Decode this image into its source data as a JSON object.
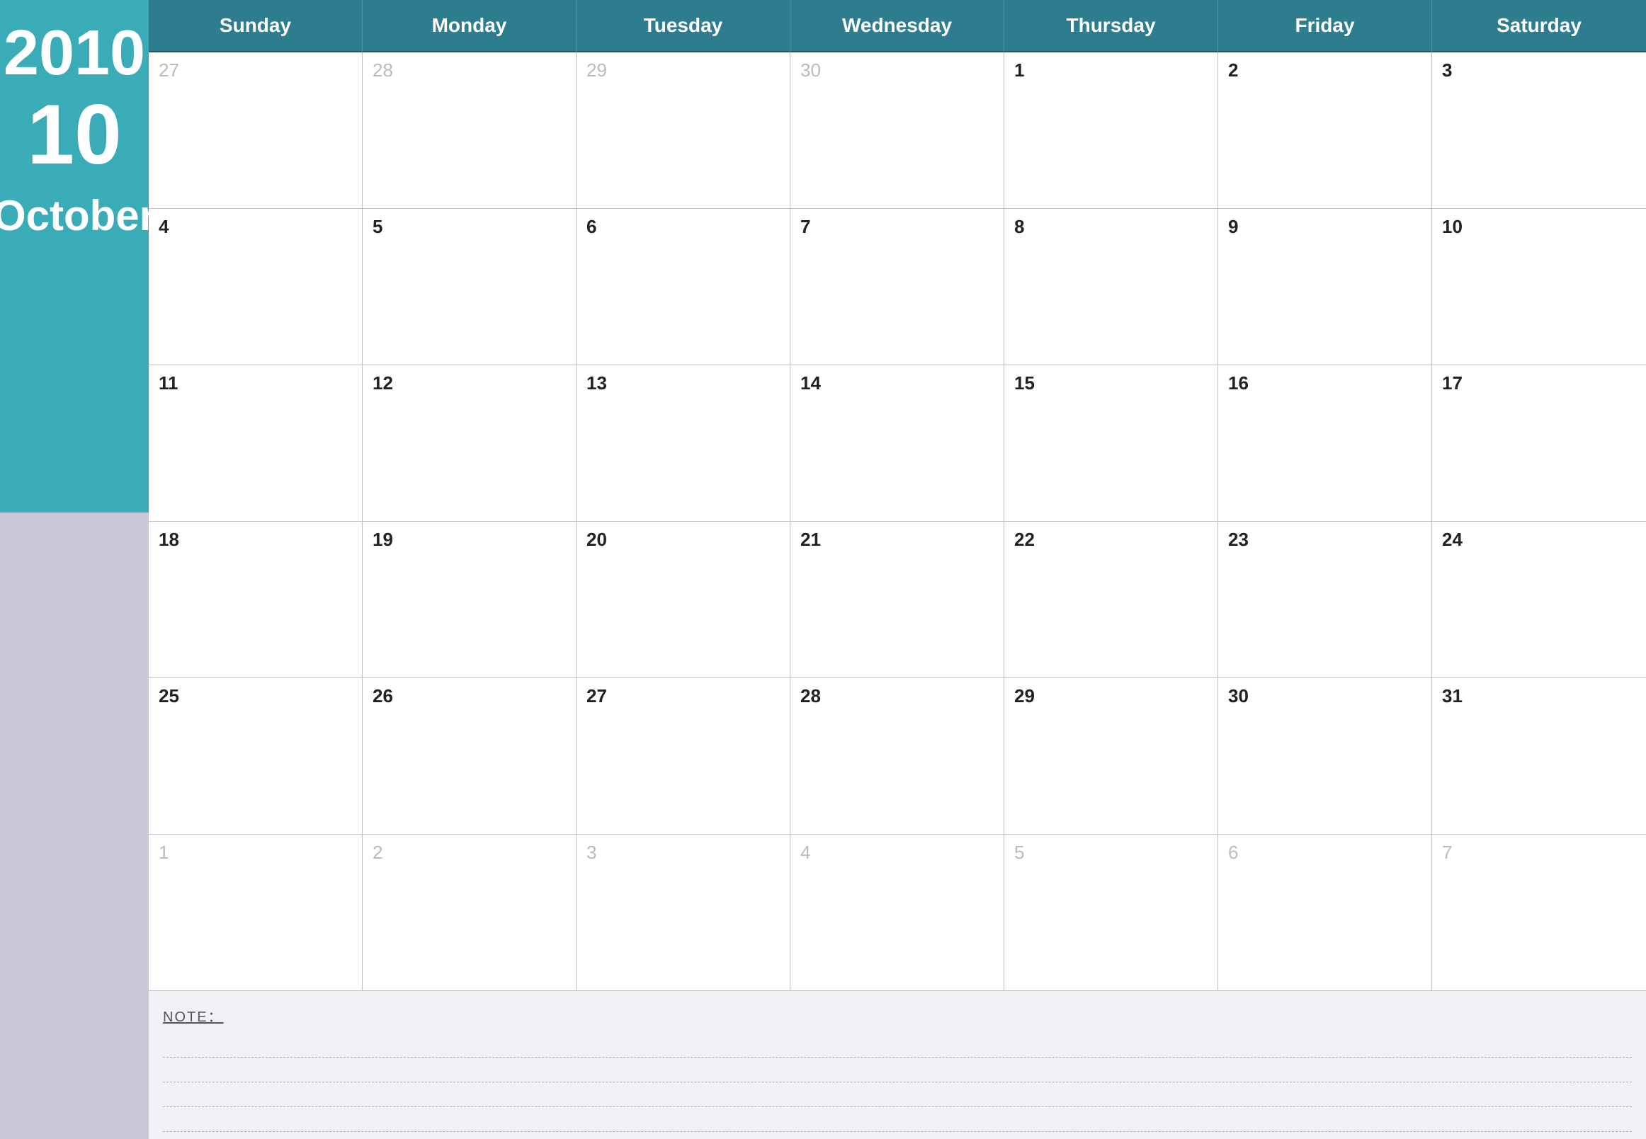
{
  "sidebar": {
    "year": "2010",
    "month_num": "10",
    "month_name": "October"
  },
  "header": {
    "days": [
      "Sunday",
      "Monday",
      "Tuesday",
      "Wednesday",
      "Thursday",
      "Friday",
      "Saturday"
    ]
  },
  "weeks": [
    [
      {
        "num": "27",
        "muted": true
      },
      {
        "num": "28",
        "muted": true
      },
      {
        "num": "29",
        "muted": true
      },
      {
        "num": "30",
        "muted": true
      },
      {
        "num": "1",
        "muted": false
      },
      {
        "num": "2",
        "muted": false
      },
      {
        "num": "3",
        "muted": false
      }
    ],
    [
      {
        "num": "4",
        "muted": false
      },
      {
        "num": "5",
        "muted": false
      },
      {
        "num": "6",
        "muted": false
      },
      {
        "num": "7",
        "muted": false
      },
      {
        "num": "8",
        "muted": false
      },
      {
        "num": "9",
        "muted": false
      },
      {
        "num": "10",
        "muted": false
      }
    ],
    [
      {
        "num": "11",
        "muted": false
      },
      {
        "num": "12",
        "muted": false
      },
      {
        "num": "13",
        "muted": false
      },
      {
        "num": "14",
        "muted": false
      },
      {
        "num": "15",
        "muted": false
      },
      {
        "num": "16",
        "muted": false
      },
      {
        "num": "17",
        "muted": false
      }
    ],
    [
      {
        "num": "18",
        "muted": false
      },
      {
        "num": "19",
        "muted": false
      },
      {
        "num": "20",
        "muted": false
      },
      {
        "num": "21",
        "muted": false
      },
      {
        "num": "22",
        "muted": false
      },
      {
        "num": "23",
        "muted": false
      },
      {
        "num": "24",
        "muted": false
      }
    ],
    [
      {
        "num": "25",
        "muted": false
      },
      {
        "num": "26",
        "muted": false
      },
      {
        "num": "27",
        "muted": false
      },
      {
        "num": "28",
        "muted": false
      },
      {
        "num": "29",
        "muted": false
      },
      {
        "num": "30",
        "muted": false
      },
      {
        "num": "31",
        "muted": false
      }
    ],
    [
      {
        "num": "1",
        "muted": true
      },
      {
        "num": "2",
        "muted": true
      },
      {
        "num": "3",
        "muted": true
      },
      {
        "num": "4",
        "muted": true
      },
      {
        "num": "5",
        "muted": true
      },
      {
        "num": "6",
        "muted": true
      },
      {
        "num": "7",
        "muted": true
      }
    ]
  ],
  "notes": {
    "label": "NOTE：",
    "lines": 4
  }
}
